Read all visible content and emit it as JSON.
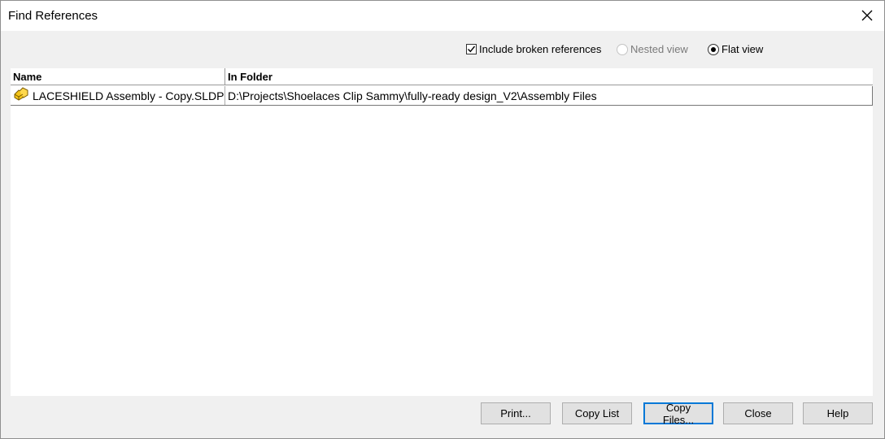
{
  "window": {
    "title": "Find References",
    "close_icon": "close-icon"
  },
  "options": {
    "include_broken": {
      "label": "Include broken references",
      "checked": true
    },
    "nested_view": {
      "label": "Nested view",
      "selected": false,
      "enabled": false
    },
    "flat_view": {
      "label": "Flat view",
      "selected": true,
      "enabled": true
    }
  },
  "table": {
    "columns": [
      "Name",
      "In Folder"
    ],
    "rows": [
      {
        "icon": "assembly-icon",
        "name": "LACESHIELD Assembly - Copy.SLDP",
        "folder": "D:\\Projects\\Shoelaces Clip Sammy\\fully-ready design_V2\\Assembly Files"
      }
    ]
  },
  "buttons": {
    "print": "Print...",
    "copy_list": "Copy List",
    "copy_files": "Copy Files...",
    "close": "Close",
    "help": "Help"
  },
  "colors": {
    "focus_border": "#0078d7",
    "icon_yellow": "#f5c518"
  }
}
